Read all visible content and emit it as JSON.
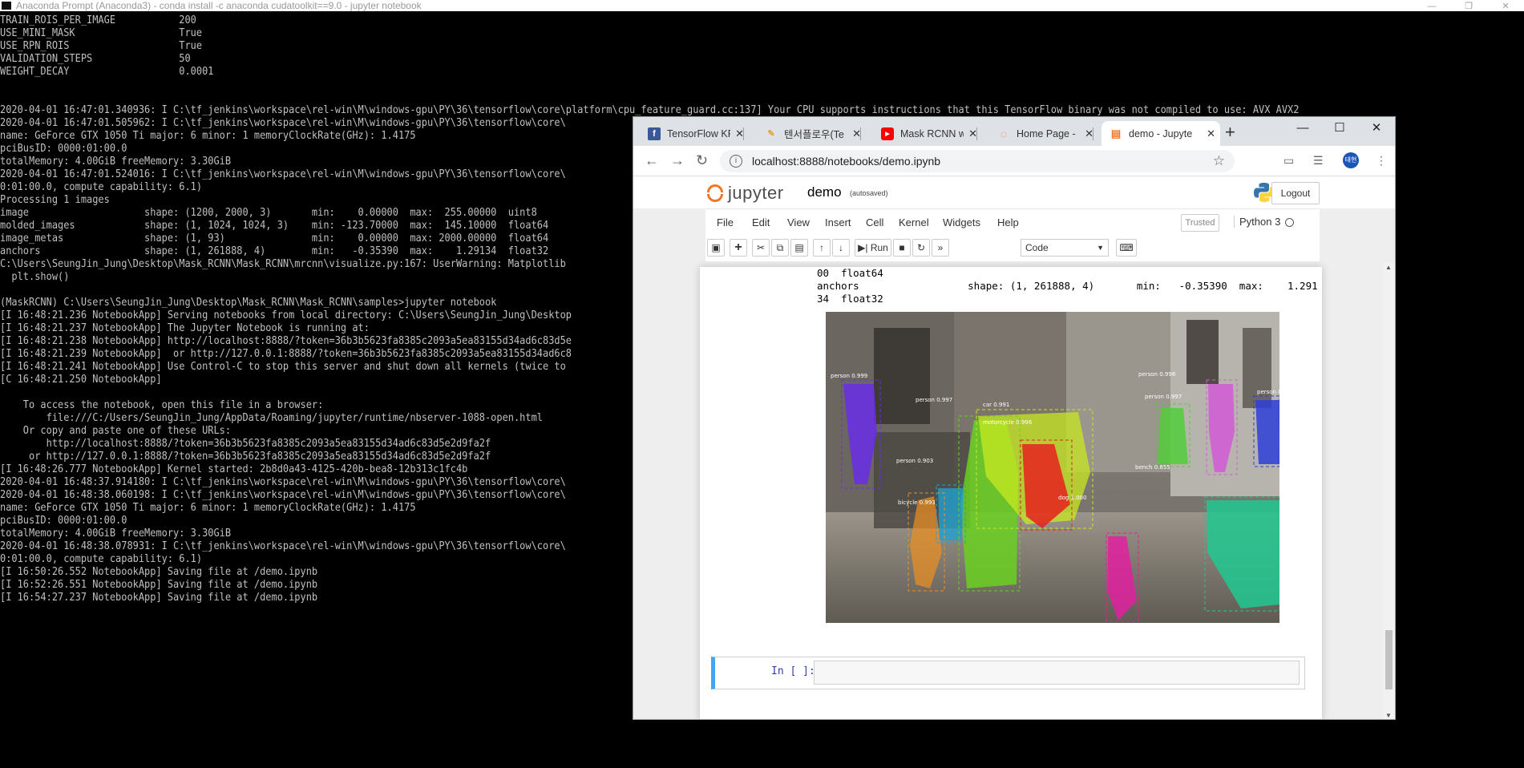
{
  "console": {
    "title": "Anaconda Prompt (Anaconda3) - conda  install -c anaconda cudatoolkit==9.0 - jupyter  notebook",
    "lines": [
      "TRAIN_ROIS_PER_IMAGE           200",
      "USE_MINI_MASK                  True",
      "USE_RPN_ROIS                   True",
      "VALIDATION_STEPS               50",
      "WEIGHT_DECAY                   0.0001",
      "",
      "",
      "2020-04-01 16:47:01.340936: I C:\\tf_jenkins\\workspace\\rel-win\\M\\windows-gpu\\PY\\36\\tensorflow\\core\\platform\\cpu_feature_guard.cc:137] Your CPU supports instructions that this TensorFlow binary was not compiled to use: AVX AVX2",
      "2020-04-01 16:47:01.505962: I C:\\tf_jenkins\\workspace\\rel-win\\M\\windows-gpu\\PY\\36\\tensorflow\\core\\",
      "name: GeForce GTX 1050 Ti major: 6 minor: 1 memoryClockRate(GHz): 1.4175",
      "pciBusID: 0000:01:00.0",
      "totalMemory: 4.00GiB freeMemory: 3.30GiB",
      "2020-04-01 16:47:01.524016: I C:\\tf_jenkins\\workspace\\rel-win\\M\\windows-gpu\\PY\\36\\tensorflow\\core\\                                                                                         Ti, pci bus id: 000",
      "0:01:00.0, compute capability: 6.1)",
      "Processing 1 images",
      "image                    shape: (1200, 2000, 3)       min:    0.00000  max:  255.00000  uint8",
      "molded_images            shape: (1, 1024, 1024, 3)    min: -123.70000  max:  145.10000  float64",
      "image_metas              shape: (1, 93)               min:    0.00000  max: 2000.00000  float64",
      "anchors                  shape: (1, 261888, 4)        min:   -0.35390  max:    1.29134  float32",
      "C:\\Users\\SeungJin_Jung\\Desktop\\Mask_RCNN\\Mask_RCNN\\mrcnn\\visualize.py:167: UserWarning: Matplotlib",
      "  plt.show()",
      "",
      "(MaskRCNN) C:\\Users\\SeungJin_Jung\\Desktop\\Mask_RCNN\\Mask_RCNN\\samples>jupyter notebook",
      "[I 16:48:21.236 NotebookApp] Serving notebooks from local directory: C:\\Users\\SeungJin_Jung\\Desktop",
      "[I 16:48:21.237 NotebookApp] The Jupyter Notebook is running at:",
      "[I 16:48:21.238 NotebookApp] http://localhost:8888/?token=36b3b5623fa8385c2093a5ea83155d34ad6c83d5e",
      "[I 16:48:21.239 NotebookApp]  or http://127.0.0.1:8888/?token=36b3b5623fa8385c2093a5ea83155d34ad6c8",
      "[I 16:48:21.241 NotebookApp] Use Control-C to stop this server and shut down all kernels (twice to",
      "[C 16:48:21.250 NotebookApp]",
      "",
      "    To access the notebook, open this file in a browser:",
      "        file:///C:/Users/SeungJin_Jung/AppData/Roaming/jupyter/runtime/nbserver-1088-open.html",
      "    Or copy and paste one of these URLs:",
      "        http://localhost:8888/?token=36b3b5623fa8385c2093a5ea83155d34ad6c83d5e2d9fa2f",
      "     or http://127.0.0.1:8888/?token=36b3b5623fa8385c2093a5ea83155d34ad6c83d5e2d9fa2f",
      "[I 16:48:26.777 NotebookApp] Kernel started: 2b8d0a43-4125-420b-bea8-12b313c1fc4b",
      "2020-04-01 16:48:37.914180: I C:\\tf_jenkins\\workspace\\rel-win\\M\\windows-gpu\\PY\\36\\tensorflow\\core\\                                                                                         AVX AVX2",
      "2020-04-01 16:48:38.060198: I C:\\tf_jenkins\\workspace\\rel-win\\M\\windows-gpu\\PY\\36\\tensorflow\\core\\",
      "name: GeForce GTX 1050 Ti major: 6 minor: 1 memoryClockRate(GHz): 1.4175",
      "pciBusID: 0000:01:00.0",
      "totalMemory: 4.00GiB freeMemory: 3.30GiB",
      "2020-04-01 16:48:38.078931: I C:\\tf_jenkins\\workspace\\rel-win\\M\\windows-gpu\\PY\\36\\tensorflow\\core\\                                                                                         Ti, pci bus id: 000",
      "0:01:00.0, compute capability: 6.1)",
      "[I 16:50:26.552 NotebookApp] Saving file at /demo.ipynb",
      "[I 16:52:26.551 NotebookApp] Saving file at /demo.ipynb",
      "[I 16:54:27.237 NotebookApp] Saving file at /demo.ipynb"
    ],
    "controls": {
      "minimize": "—",
      "maximize": "❐",
      "close": "✕"
    }
  },
  "browser": {
    "tabs": [
      {
        "label": "TensorFlow KR",
        "icon": "facebook-icon",
        "color": "#3b5998",
        "glyph": "f"
      },
      {
        "label": "텐서플로우(Te",
        "icon": "pencil-icon",
        "color": "#e8a33d",
        "glyph": "✎"
      },
      {
        "label": "Mask RCNN w",
        "icon": "youtube-icon",
        "color": "#ff0000",
        "glyph": "▶"
      },
      {
        "label": "Home Page - ",
        "icon": "jupyter-icon",
        "color": "#f37626",
        "glyph": "◌"
      },
      {
        "label": "demo - Jupyte",
        "icon": "notebook-icon",
        "color": "#f37626",
        "glyph": "▤"
      }
    ],
    "new_tab": "+",
    "controls": {
      "minimize": "—",
      "maximize": "☐",
      "close": "✕"
    },
    "url": "localhost:8888/notebooks/demo.ipynb",
    "profile_initials": "태현"
  },
  "jupyter": {
    "logo_text": "jupyter",
    "notebook_name": "demo",
    "autosave_status": "(autosaved)",
    "logout_label": "Logout",
    "menu": [
      "File",
      "Edit",
      "View",
      "Insert",
      "Cell",
      "Kernel",
      "Widgets",
      "Help"
    ],
    "trusted_label": "Trusted",
    "kernel_name": "Python 3",
    "toolbar": {
      "run_label": "Run",
      "cell_type": "Code"
    },
    "output_lines": [
      "00  float64",
      "anchors                  shape: (1, 261888, 4)       min:   -0.35390  max:    1.291",
      "34  float32"
    ],
    "input_prompt": "In [ ]:",
    "detections": [
      {
        "label": "person 0.999",
        "color": "#6a2ee8"
      },
      {
        "label": "person 0.998",
        "color": "#d25bd6"
      },
      {
        "label": "person 0.988",
        "color": "#2e3ed8"
      },
      {
        "label": "person 0.997",
        "color": "#52cc3a"
      },
      {
        "label": "person 0.997",
        "color": "#6ad020"
      },
      {
        "label": "car 0.991",
        "color": "#c8e820"
      },
      {
        "label": "motorcycle 0.996",
        "color": "#e82020"
      },
      {
        "label": "bicycle 0.993",
        "color": "#f09020"
      },
      {
        "label": "person 0.903",
        "color": "#20a0d0"
      },
      {
        "label": "dog 1.000",
        "color": "#e020a0"
      },
      {
        "label": "bench 0.855",
        "color": "#20c890"
      }
    ]
  }
}
